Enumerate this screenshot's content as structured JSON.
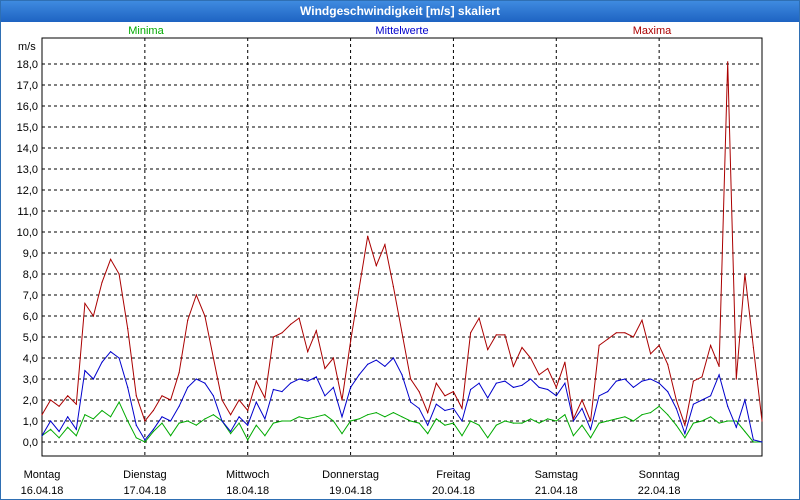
{
  "window": {
    "title": "Windgeschwindigkeit [m/s] skaliert"
  },
  "chart_data": {
    "type": "line",
    "title": "Windgeschwindigkeit [m/s] skaliert",
    "ylabel": "m/s",
    "ylim": [
      0,
      18.5
    ],
    "yticks": [
      "0,0",
      "1,0",
      "2,0",
      "3,0",
      "4,0",
      "5,0",
      "6,0",
      "7,0",
      "8,0",
      "9,0",
      "10,0",
      "11,0",
      "12,0",
      "13,0",
      "14,0",
      "15,0",
      "16,0",
      "17,0",
      "18,0"
    ],
    "days": [
      {
        "day": "Montag",
        "date": "16.04.18"
      },
      {
        "day": "Dienstag",
        "date": "17.04.18"
      },
      {
        "day": "Mittwoch",
        "date": "18.04.18"
      },
      {
        "day": "Donnerstag",
        "date": "19.04.18"
      },
      {
        "day": "Freitag",
        "date": "20.04.18"
      },
      {
        "day": "Samstag",
        "date": "21.04.18"
      },
      {
        "day": "Sonntag",
        "date": "22.04.18"
      }
    ],
    "x_unit": "hours since start of 16.04.18",
    "xlim": [
      0,
      168
    ],
    "grid": true,
    "legend_position": "top",
    "series": [
      {
        "name": "Minima",
        "color": "#00aa00",
        "x": [
          0,
          2,
          4,
          6,
          8,
          10,
          12,
          14,
          16,
          18,
          20,
          22,
          24,
          26,
          28,
          30,
          32,
          34,
          36,
          38,
          40,
          42,
          44,
          46,
          48,
          50,
          52,
          54,
          56,
          58,
          60,
          62,
          64,
          66,
          68,
          70,
          72,
          74,
          76,
          78,
          80,
          82,
          84,
          86,
          88,
          90,
          92,
          94,
          96,
          98,
          100,
          102,
          104,
          106,
          108,
          110,
          112,
          114,
          116,
          118,
          120,
          122,
          124,
          126,
          128,
          130,
          132,
          134,
          136,
          138,
          140,
          142,
          144,
          146,
          148,
          150,
          152,
          154,
          156,
          158,
          160,
          162,
          164,
          166,
          168
        ],
        "values": [
          0.3,
          0.6,
          0.2,
          0.7,
          0.3,
          1.3,
          1.1,
          1.5,
          1.2,
          1.9,
          1.0,
          0.2,
          0.0,
          0.5,
          0.9,
          0.3,
          0.9,
          1.0,
          0.8,
          1.1,
          1.3,
          1.0,
          0.4,
          0.9,
          0.1,
          0.8,
          0.3,
          0.9,
          1.0,
          1.0,
          1.2,
          1.1,
          1.2,
          1.3,
          1.0,
          0.4,
          1.0,
          1.1,
          1.3,
          1.4,
          1.2,
          1.4,
          1.2,
          1.0,
          0.9,
          0.4,
          1.1,
          0.8,
          0.9,
          0.3,
          1.0,
          0.8,
          0.2,
          0.8,
          1.0,
          0.9,
          0.9,
          1.1,
          0.9,
          1.1,
          1.0,
          1.3,
          0.3,
          0.8,
          0.2,
          0.9,
          1.0,
          1.1,
          1.2,
          1.0,
          1.3,
          1.4,
          1.7,
          1.3,
          0.8,
          0.2,
          0.9,
          1.0,
          1.2,
          0.9,
          1.0,
          1.0,
          0.5,
          0.0,
          0.0
        ]
      },
      {
        "name": "Mittelwerte",
        "color": "#0000cc",
        "x": [
          0,
          2,
          4,
          6,
          8,
          10,
          12,
          14,
          16,
          18,
          20,
          22,
          24,
          26,
          28,
          30,
          32,
          34,
          36,
          38,
          40,
          42,
          44,
          46,
          48,
          50,
          52,
          54,
          56,
          58,
          60,
          62,
          64,
          66,
          68,
          70,
          72,
          74,
          76,
          78,
          80,
          82,
          84,
          86,
          88,
          90,
          92,
          94,
          96,
          98,
          100,
          102,
          104,
          106,
          108,
          110,
          112,
          114,
          116,
          118,
          120,
          122,
          124,
          126,
          128,
          130,
          132,
          134,
          136,
          138,
          140,
          142,
          144,
          146,
          148,
          150,
          152,
          154,
          156,
          158,
          160,
          162,
          164,
          166,
          168
        ],
        "values": [
          0.3,
          1.0,
          0.5,
          1.2,
          0.6,
          3.4,
          3.0,
          3.8,
          4.3,
          4.0,
          2.6,
          0.8,
          0.1,
          0.6,
          1.2,
          1.0,
          1.7,
          2.6,
          3.0,
          2.8,
          2.2,
          1.0,
          0.5,
          1.2,
          0.8,
          1.9,
          1.1,
          2.5,
          2.4,
          2.8,
          3.0,
          2.9,
          3.1,
          2.2,
          2.6,
          1.2,
          2.6,
          3.2,
          3.7,
          3.9,
          3.6,
          4.0,
          3.2,
          1.9,
          1.6,
          0.8,
          1.8,
          1.5,
          1.6,
          1.0,
          2.5,
          2.8,
          2.1,
          2.8,
          2.9,
          2.6,
          2.7,
          3.0,
          2.6,
          2.5,
          2.2,
          2.8,
          1.0,
          1.6,
          0.6,
          2.2,
          2.4,
          2.9,
          3.0,
          2.6,
          2.9,
          3.0,
          2.8,
          2.4,
          1.6,
          0.4,
          1.8,
          2.0,
          2.2,
          3.2,
          1.7,
          0.7,
          2.0,
          0.1,
          0.0
        ]
      },
      {
        "name": "Maxima",
        "color": "#aa0000",
        "x": [
          0,
          2,
          4,
          6,
          8,
          10,
          12,
          14,
          16,
          18,
          20,
          22,
          24,
          26,
          28,
          30,
          32,
          34,
          36,
          38,
          40,
          42,
          44,
          46,
          48,
          50,
          52,
          54,
          56,
          58,
          60,
          62,
          64,
          66,
          68,
          70,
          72,
          74,
          76,
          78,
          80,
          82,
          84,
          86,
          88,
          90,
          92,
          94,
          96,
          98,
          100,
          102,
          104,
          106,
          108,
          110,
          112,
          114,
          116,
          118,
          120,
          122,
          124,
          126,
          128,
          130,
          132,
          134,
          136,
          138,
          140,
          142,
          144,
          146,
          148,
          150,
          152,
          154,
          156,
          158,
          160,
          162,
          164,
          166,
          168
        ],
        "values": [
          1.3,
          2.0,
          1.7,
          2.2,
          1.8,
          6.6,
          6.0,
          7.6,
          8.7,
          8.0,
          5.4,
          2.2,
          1.0,
          1.5,
          2.2,
          2.0,
          3.3,
          5.8,
          7.0,
          6.0,
          4.0,
          2.0,
          1.3,
          2.0,
          1.5,
          2.9,
          2.1,
          5.0,
          5.2,
          5.6,
          5.9,
          4.3,
          5.3,
          3.5,
          4.0,
          2.0,
          4.8,
          7.3,
          9.8,
          8.4,
          9.4,
          7.4,
          5.2,
          3.0,
          2.4,
          1.4,
          2.8,
          2.2,
          2.4,
          1.6,
          5.2,
          5.9,
          4.4,
          5.1,
          5.1,
          3.6,
          4.5,
          4.0,
          3.2,
          3.5,
          2.6,
          3.8,
          1.1,
          2.0,
          1.0,
          4.6,
          4.9,
          5.2,
          5.2,
          5.0,
          5.8,
          4.2,
          4.6,
          3.7,
          2.0,
          0.8,
          2.9,
          3.1,
          4.6,
          3.6,
          18.1,
          3.0,
          8.0,
          4.5,
          1.0
        ]
      }
    ]
  }
}
